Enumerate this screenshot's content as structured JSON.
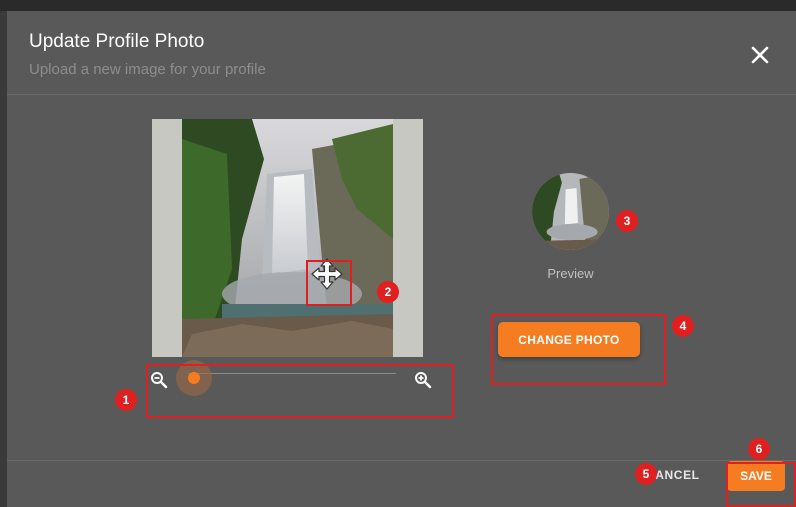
{
  "dialog": {
    "title": "Update Profile Photo",
    "subtitle": "Upload a new image for your profile",
    "close_icon": "close-icon"
  },
  "cropper": {
    "zoom_out_icon": "zoom-out-icon",
    "zoom_in_icon": "zoom-in-icon",
    "move_icon": "move-arrows-icon",
    "zoom_level": 0
  },
  "preview": {
    "label": "Preview"
  },
  "actions": {
    "change_photo": "CHANGE PHOTO",
    "cancel": "CANCEL",
    "save": "SAVE"
  },
  "callouts": [
    "1",
    "2",
    "3",
    "4",
    "5",
    "6"
  ],
  "colors": {
    "accent": "#f57c20",
    "dialog_bg": "#595959",
    "highlight": "#e02020"
  }
}
